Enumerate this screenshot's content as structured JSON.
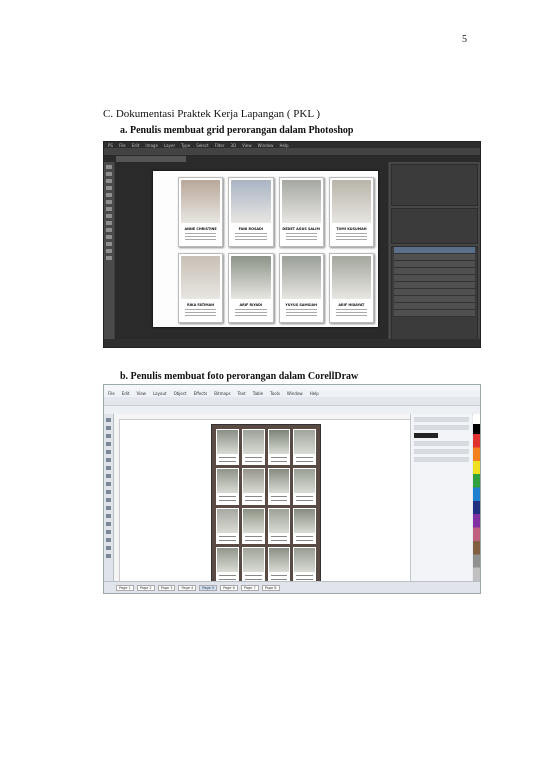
{
  "page_number": "5",
  "section_heading": "C.   Dokumentasi Praktek Kerja Lapangan ( PKL )",
  "sub_a": "a.   Penulis membuat grid perorangan dalam Photoshop",
  "sub_b": "b.   Penulis membuat foto perorangan dalam CorellDraw",
  "photoshop": {
    "menu": [
      "PS",
      "File",
      "Edit",
      "Image",
      "Layer",
      "Type",
      "Select",
      "Filter",
      "3D",
      "View",
      "Window",
      "Help"
    ],
    "cards": [
      {
        "name": "ANNE CHRISTINE",
        "color": "#b9a89a"
      },
      {
        "name": "FANI ROSADI",
        "color": "#a9b4c4"
      },
      {
        "name": "DEDET AGUS SALIM",
        "color": "#a5a8a2"
      },
      {
        "name": "TOMI KUSUMAH",
        "color": "#b8b4a9"
      },
      {
        "name": "RIKA FATIMAH",
        "color": "#c8c0b5"
      },
      {
        "name": "ARIF RIYADI",
        "color": "#8c9488"
      },
      {
        "name": "YUYUS SAMSIAH",
        "color": "#9a9f98"
      },
      {
        "name": "ARIF HIDAYAT",
        "color": "#a4a79e"
      }
    ]
  },
  "coreldraw": {
    "menu": [
      "File",
      "Edit",
      "View",
      "Layout",
      "Object",
      "Effects",
      "Bitmaps",
      "Text",
      "Table",
      "Tools",
      "Window",
      "Help"
    ],
    "page_tabs": [
      "Page 1",
      "Page 2",
      "Page 3",
      "Page 4",
      "Page 5",
      "Page 6",
      "Page 7",
      "Page 8"
    ],
    "active_tab_index": 4,
    "photo_colors": [
      "#8a8f86",
      "#9ea39a",
      "#7d8578",
      "#a0a59c",
      "#8f9488",
      "#98958c",
      "#868b80",
      "#9aa096",
      "#a8a8a2",
      "#8e9386",
      "#9da196",
      "#878c80",
      "#92978c",
      "#a1a59b",
      "#8b9085",
      "#989c92"
    ]
  }
}
